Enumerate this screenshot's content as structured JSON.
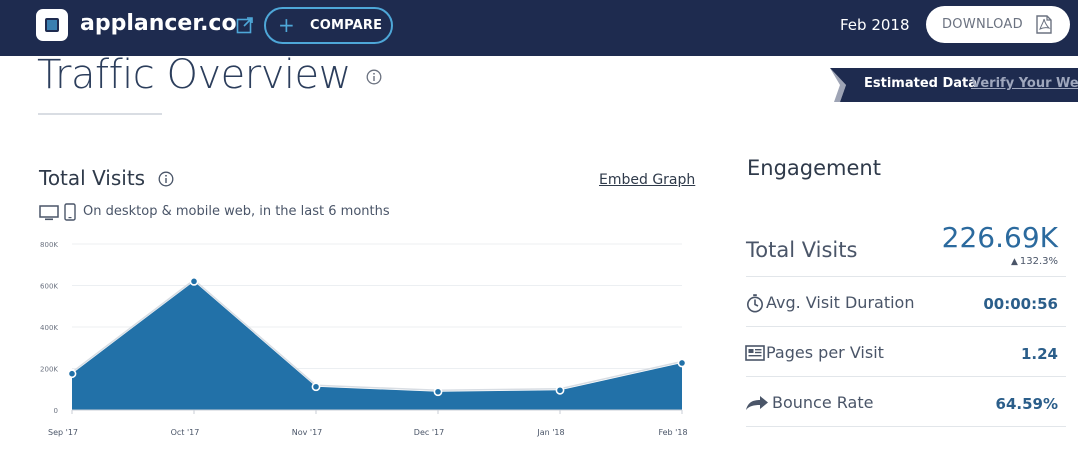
{
  "header": {
    "site_name": "applancer.co",
    "compare_label": "COMPARE",
    "date": "Feb 2018",
    "download_label": "DOWNLOAD"
  },
  "page": {
    "title": "Traffic Overview",
    "estimated_label": "Estimated Data",
    "verify_link": "Verify Your Webs"
  },
  "total_visits_card": {
    "title": "Total Visits",
    "embed_label": "Embed Graph",
    "device_note": "On desktop & mobile web, in the last 6 months"
  },
  "chart_data": {
    "type": "area",
    "categories": [
      "Sep '17",
      "Oct '17",
      "Nov '17",
      "Dec '17",
      "Jan '18",
      "Feb '18"
    ],
    "series": [
      {
        "values": [
          175000,
          620000,
          112000,
          88000,
          95000,
          226690
        ]
      }
    ],
    "y_ticks": [
      "0",
      "200K",
      "400K",
      "600K",
      "800K"
    ],
    "ylim": [
      0,
      800000
    ],
    "grid": true,
    "colors": {
      "fill": "#2271a8",
      "line": "#d8dde3",
      "point": "#2271a8"
    }
  },
  "engagement": {
    "title": "Engagement",
    "total_visits_label": "Total Visits",
    "total_visits_value": "226.69K",
    "total_visits_change": "132.3%",
    "rows": [
      {
        "label": "Avg. Visit Duration",
        "value": "00:00:56",
        "icon": "stopwatch-icon"
      },
      {
        "label": "Pages per Visit",
        "value": "1.24",
        "icon": "pages-icon"
      },
      {
        "label": "Bounce Rate",
        "value": "64.59%",
        "icon": "bounce-arrow-icon"
      }
    ]
  },
  "colors": {
    "header_bg": "#1e2b4f",
    "accent": "#4ea7d8",
    "value_blue": "#2b6a9e"
  }
}
